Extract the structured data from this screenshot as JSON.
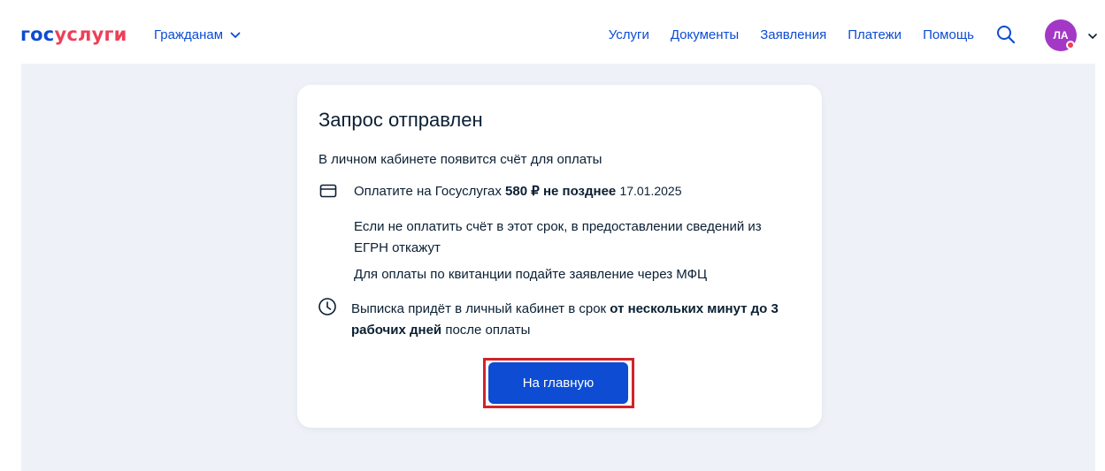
{
  "header": {
    "logo": {
      "part1": "гос",
      "part2": "услуги"
    },
    "audience_label": "Гражданам",
    "nav": [
      "Услуги",
      "Документы",
      "Заявления",
      "Платежи",
      "Помощь"
    ],
    "user_initials": "ЛА"
  },
  "card": {
    "title": "Запрос отправлен",
    "intro": "В личном кабинете появится счёт для оплаты",
    "payment": {
      "prefix": "Оплатите на Госуслугах",
      "amount": "580 ₽",
      "deadline_label": "не позднее",
      "deadline_date": "17.01.2025"
    },
    "warning": "Если не оплатить счёт в этот срок, в предоставлении сведений из ЕГРН откажут",
    "mfc_note": "Для оплаты по квитанции подайте заявление через МФЦ",
    "extract": {
      "prefix": "Выписка придёт в личный кабинет в срок",
      "bold": "от нескольких минут до 3 рабочих дней",
      "suffix": "после оплаты"
    },
    "home_button": "На главную"
  },
  "colors": {
    "brand_blue": "#0d4cd3",
    "brand_red": "#ee3f58",
    "avatar": "#a338c7",
    "highlight_frame": "#d2232a",
    "page_bg": "#eef2f8"
  },
  "icons": [
    "chevron-down-icon",
    "search-icon",
    "card-icon",
    "clock-icon"
  ]
}
